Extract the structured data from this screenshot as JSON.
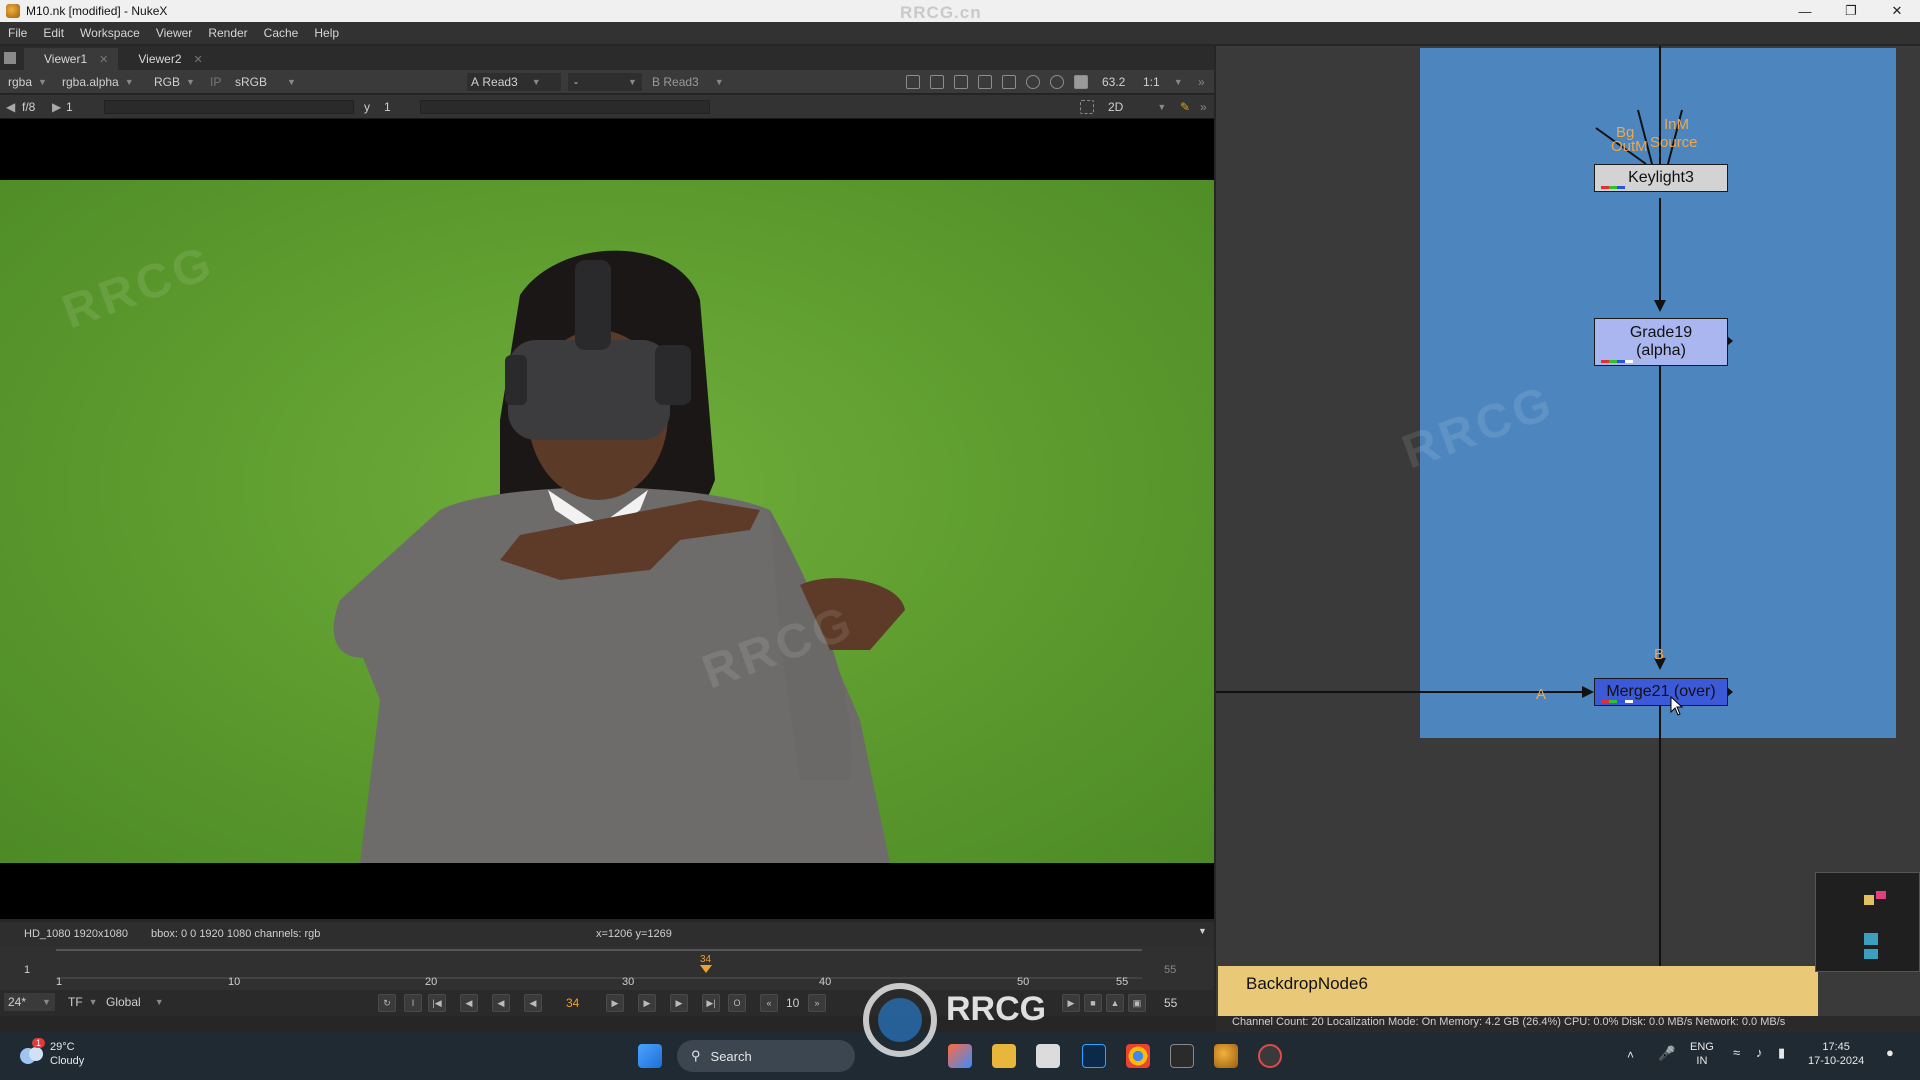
{
  "window": {
    "title": "M10.nk [modified] - NukeX",
    "watermark_text": "RRCG.cn"
  },
  "menu": [
    "File",
    "Edit",
    "Workspace",
    "Viewer",
    "Render",
    "Cache",
    "Help"
  ],
  "tabs": [
    {
      "label": "Viewer1"
    },
    {
      "label": "Viewer2"
    }
  ],
  "viewer_toolbar": {
    "channels": "rgba",
    "layer": "rgba.alpha",
    "display": "RGB",
    "ip": "IP",
    "lut": "sRGB",
    "a_label": "A",
    "a_input": "Read3",
    "composite": "-",
    "b_label": "B",
    "b_input": "Read3",
    "zoom": "63.2",
    "ratio": "1:1"
  },
  "viewer_controls": {
    "fstop": "f/8",
    "frame_gain": "1",
    "y_label": "y",
    "gamma": "1",
    "view_mode": "2D"
  },
  "info_bar": {
    "format": "HD_1080 1920x1080",
    "bbox": "bbox: 0 0 1920 1080 channels: rgb",
    "coords": "x=1206 y=1269"
  },
  "timeline": {
    "start": "1",
    "end": "55",
    "current": "34",
    "ticks": [
      "1",
      "10",
      "20",
      "30",
      "40",
      "50",
      "55"
    ],
    "fps": "24*",
    "tf": "TF",
    "scope": "Global",
    "step": "10",
    "end_frame": "55"
  },
  "nodes": {
    "keylight": {
      "name": "Keylight3",
      "inputs": [
        "Bg",
        "InM",
        "OutM",
        "Source"
      ]
    },
    "grade": {
      "name": "Grade19",
      "sub": "(alpha)"
    },
    "merge": {
      "name": "Merge21 (over)",
      "input_a": "A",
      "input_b": "B"
    },
    "backdrop": {
      "name": "BackdropNode6"
    }
  },
  "status": "Channel Count: 20  Localization Mode: On  Memory: 4.2 GB (26.4%)  CPU: 0.0%  Disk: 0.0 MB/s  Network: 0.0 MB/s",
  "taskbar": {
    "weather_temp": "29°C",
    "weather_desc": "Cloudy",
    "search": "Search",
    "lang1": "ENG",
    "lang2": "IN",
    "time": "17:45",
    "date": "17-10-2024",
    "notification_count": "1"
  },
  "colors": {
    "backdrop_blue": "#4d86bf",
    "backdrop_yellow": "#e9c978",
    "node_keylight": "#d3d3d3",
    "node_grade": "#a9b6f0",
    "node_merge": "#3c5ad8",
    "green_screen": "#5c9a2e"
  }
}
